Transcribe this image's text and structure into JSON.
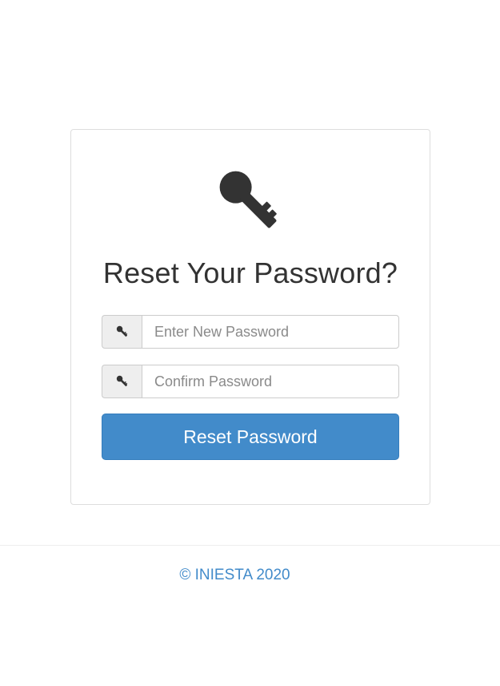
{
  "form": {
    "title": "Reset Your Password?",
    "new_password_placeholder": "Enter New Password",
    "confirm_password_placeholder": "Confirm Password",
    "submit_label": "Reset Password"
  },
  "footer": {
    "copyright": "© INIESTA 2020"
  },
  "icons": {
    "hero": "key-icon",
    "field_addon": "key-icon"
  },
  "colors": {
    "accent": "#428bca",
    "icon": "#333333",
    "addon_bg": "#eeeeee"
  }
}
